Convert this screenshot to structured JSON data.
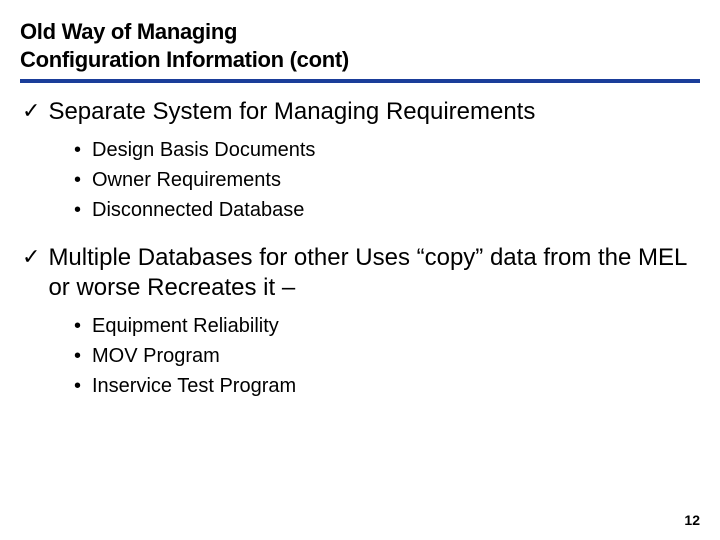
{
  "title_line1": "Old Way of Managing",
  "title_line2": "Configuration Information (cont)",
  "items": [
    {
      "text": "Separate System for Managing Requirements",
      "subs": [
        "Design Basis Documents",
        "Owner Requirements",
        "Disconnected Database"
      ]
    },
    {
      "text": "Multiple Databases for other Uses “copy” data from the MEL or worse Recreates it –",
      "subs": [
        "Equipment Reliability",
        "MOV Program",
        "Inservice Test Program"
      ]
    }
  ],
  "check_glyph": "✓",
  "page_number": "12"
}
